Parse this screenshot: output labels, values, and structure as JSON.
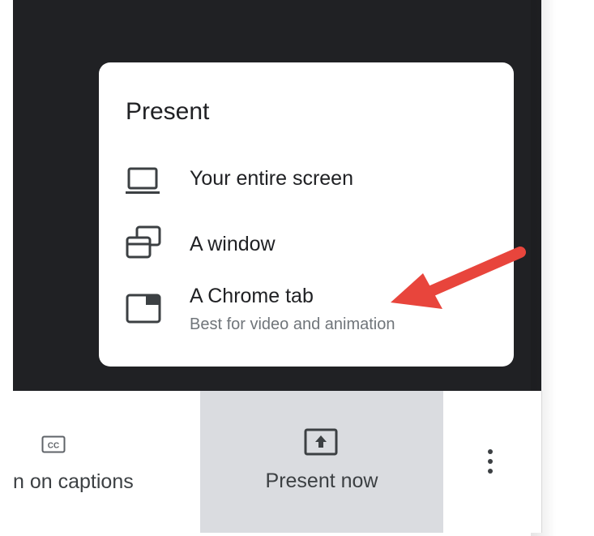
{
  "present_menu": {
    "title": "Present",
    "items": [
      {
        "label": "Your entire screen",
        "icon": "laptop-icon"
      },
      {
        "label": "A window",
        "icon": "window-icon"
      },
      {
        "label": "A Chrome tab",
        "subtitle": "Best for video and animation",
        "icon": "chrome-tab-icon"
      }
    ]
  },
  "toolbar": {
    "captions_label": "n on captions",
    "captions_icon": "closed-captions-icon",
    "present_label": "Present now",
    "present_icon": "present-screen-icon",
    "more_icon": "more-vert-icon"
  },
  "annotation": {
    "arrow_color": "#e8453c"
  },
  "colors": {
    "background_dark": "#202124",
    "present_button_bg": "#dadce0"
  }
}
